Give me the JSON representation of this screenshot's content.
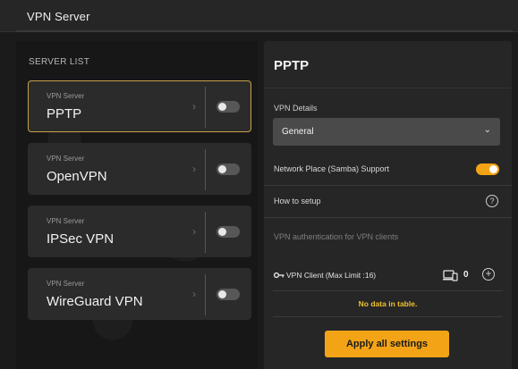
{
  "header": {
    "title": "VPN Server"
  },
  "server_list": {
    "title": "SERVER LIST",
    "items": [
      {
        "subtitle": "VPN Server",
        "name": "PPTP",
        "enabled": false,
        "selected": true
      },
      {
        "subtitle": "VPN Server",
        "name": "OpenVPN",
        "enabled": false,
        "selected": false
      },
      {
        "subtitle": "VPN Server",
        "name": "IPSec VPN",
        "enabled": false,
        "selected": false
      },
      {
        "subtitle": "VPN Server",
        "name": "WireGuard VPN",
        "enabled": false,
        "selected": false
      }
    ]
  },
  "detail": {
    "title": "PPTP",
    "vpn_details_label": "VPN Details",
    "vpn_details_value": "General",
    "network_place_label": "Network Place (Samba) Support",
    "network_place_enabled": true,
    "how_to_setup_label": "How to setup",
    "auth_label": "VPN authentication for VPN clients",
    "client_label": "VPN Client (Max Limit :16)",
    "client_count": "0",
    "no_data": "No data in table.",
    "apply_label": "Apply all settings"
  },
  "colors": {
    "accent": "#f3a416",
    "selected_border": "#c8a24a",
    "no_data_text": "#f0c12c"
  },
  "icons": {
    "chevron": "chevron-right-icon",
    "dropdown": "chevron-down-icon",
    "help": "question-icon",
    "key": "key-icon",
    "device": "device-icon",
    "add": "plus-circle-icon"
  }
}
